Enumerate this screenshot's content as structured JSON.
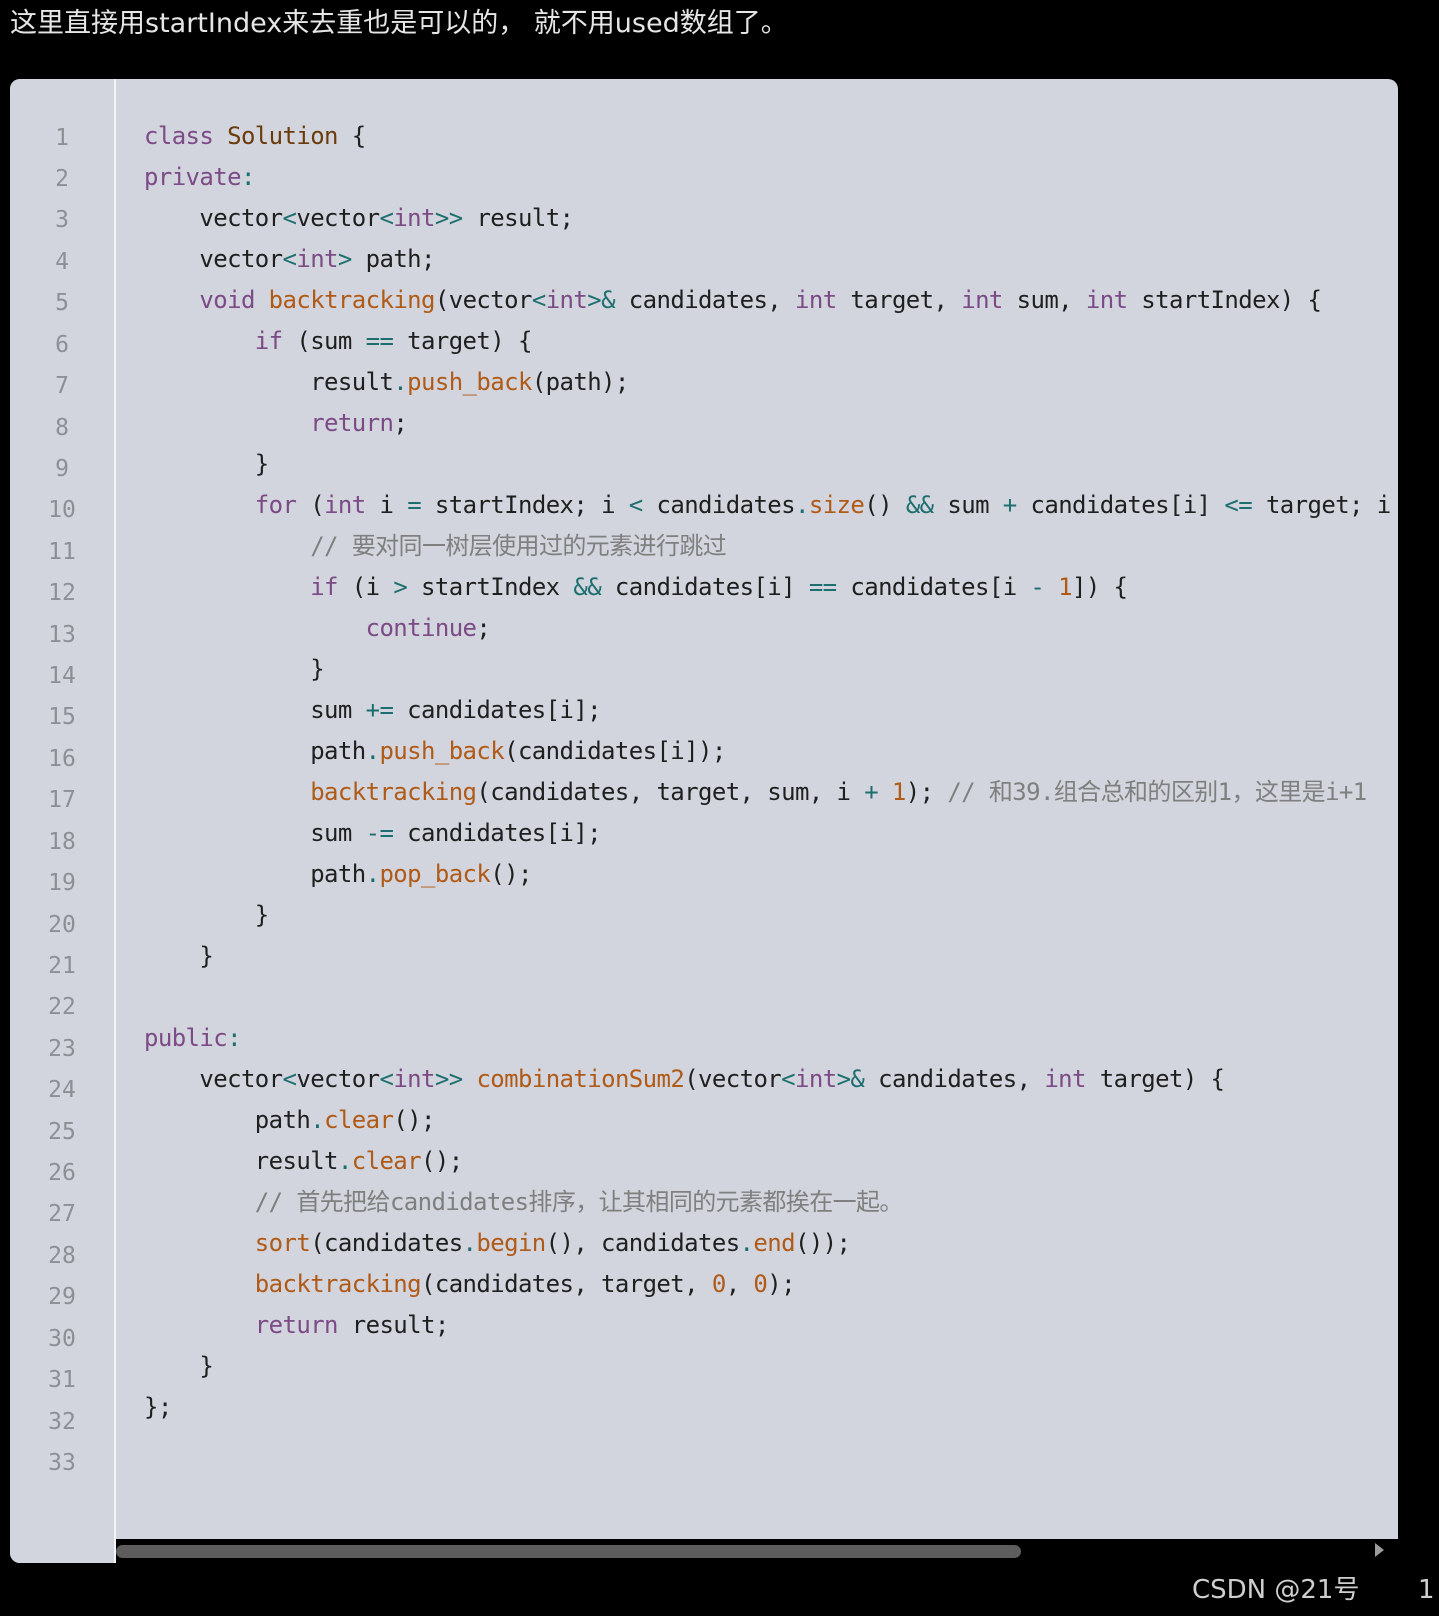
{
  "intro_text": "这里直接用startIndex来去重也是可以的， 就不用used数组了。",
  "line_numbers": [
    "1",
    "2",
    "3",
    "4",
    "5",
    "6",
    "7",
    "8",
    "9",
    "10",
    "11",
    "12",
    "13",
    "14",
    "15",
    "16",
    "17",
    "18",
    "19",
    "20",
    "21",
    "22",
    "23",
    "24",
    "25",
    "26",
    "27",
    "28",
    "29",
    "30",
    "31",
    "32",
    "33"
  ],
  "code": {
    "l1": [
      "class",
      " ",
      "Solution",
      " {"
    ],
    "l2": [
      "private",
      ":"
    ],
    "l3": [
      "    vector",
      "<",
      "vector",
      "<",
      "int",
      ">>",
      " result;"
    ],
    "l4": [
      "    vector",
      "<",
      "int",
      ">",
      " path;"
    ],
    "l5": [
      "    ",
      "void",
      " ",
      "backtracking",
      "(vector",
      "<",
      "int",
      ">&",
      " candidates, ",
      "int",
      " target, ",
      "int",
      " sum, ",
      "int",
      " startIndex) {"
    ],
    "l6": [
      "        ",
      "if",
      " (sum ",
      "==",
      " target) {"
    ],
    "l7": [
      "            result",
      ".",
      "push_back",
      "(path);"
    ],
    "l8": [
      "            ",
      "return",
      ";"
    ],
    "l9": [
      "        }"
    ],
    "l10": [
      "        ",
      "for",
      " (",
      "int",
      " i ",
      "=",
      " startIndex; i ",
      "<",
      " candidates",
      ".",
      "size",
      "() ",
      "&&",
      " sum ",
      "+",
      " candidates[i] ",
      "<=",
      " target; i"
    ],
    "l11": [
      "            // 要对同一树层使用过的元素进行跳过"
    ],
    "l12": [
      "            ",
      "if",
      " (i ",
      ">",
      " startIndex ",
      "&&",
      " candidates[i] ",
      "==",
      " candidates[i ",
      "-",
      " ",
      "1",
      "]) {"
    ],
    "l13": [
      "                ",
      "continue",
      ";"
    ],
    "l14": [
      "            }"
    ],
    "l15": [
      "            sum ",
      "+=",
      " candidates[i];"
    ],
    "l16": [
      "            path",
      ".",
      "push_back",
      "(candidates[i]);"
    ],
    "l17": [
      "            ",
      "backtracking",
      "(candidates, target, sum, i ",
      "+",
      " ",
      "1",
      "); ",
      "// 和39.组合总和的区别1，这里是i+1"
    ],
    "l18": [
      "            sum ",
      "-=",
      " candidates[i];"
    ],
    "l19": [
      "            path",
      ".",
      "pop_back",
      "();"
    ],
    "l20": [
      "        }"
    ],
    "l21": [
      "    }"
    ],
    "l22": [
      ""
    ],
    "l23": [
      "public",
      ":"
    ],
    "l24": [
      "    vector",
      "<",
      "vector",
      "<",
      "int",
      ">>",
      " ",
      "combinationSum2",
      "(vector",
      "<",
      "int",
      ">&",
      " candidates, ",
      "int",
      " target) {"
    ],
    "l25": [
      "        path",
      ".",
      "clear",
      "();"
    ],
    "l26": [
      "        result",
      ".",
      "clear",
      "();"
    ],
    "l27": [
      "        // 首先把给candidates排序，让其相同的元素都挨在一起。"
    ],
    "l28": [
      "        ",
      "sort",
      "(candidates",
      ".",
      "begin",
      "(), candidates",
      ".",
      "end",
      "());"
    ],
    "l29": [
      "        ",
      "backtracking",
      "(candidates, target, ",
      "0",
      ", ",
      "0",
      ");"
    ],
    "l30": [
      "        ",
      "return",
      " result;"
    ],
    "l31": [
      "    }"
    ],
    "l32": [
      "};"
    ],
    "l33": [
      ""
    ]
  },
  "footer": {
    "brand": "CSDN @21号",
    "page": "1"
  },
  "colors": {
    "background": "#000000",
    "code_background": "#d2d5dd",
    "keyword": "#7c4a86",
    "function": "#b05a18",
    "class_name": "#6a3b0b",
    "operator": "#1d6f6f",
    "comment": "#7f7f7f"
  }
}
